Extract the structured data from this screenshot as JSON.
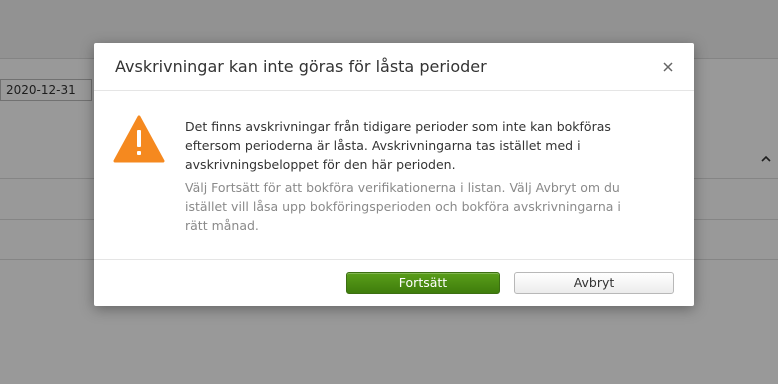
{
  "background": {
    "date_value": "2020-12-31"
  },
  "dialog": {
    "title": "Avskrivningar kan inte göras för låsta perioder",
    "close_icon": "close-icon",
    "warning_icon": "warning-triangle-icon",
    "message_lines": [
      "Det finns avskrivningar från tidigare perioder som inte kan bokföras",
      "eftersom perioderna är låsta. Avskrivningarna tas istället med i",
      "avskrivningsbeloppet för den här perioden."
    ],
    "hint_lines": [
      "Välj Fortsätt för att bokföra verifikationerna i listan. Välj Avbryt om du",
      "istället vill låsa upp bokföringsperioden och bokföra avskrivningarna i",
      "rätt månad."
    ],
    "continue_label": "Fortsätt",
    "cancel_label": "Avbryt"
  },
  "colors": {
    "primary_button": "#4a8c13",
    "warning": "#f5891f",
    "overlay": "#000000"
  }
}
